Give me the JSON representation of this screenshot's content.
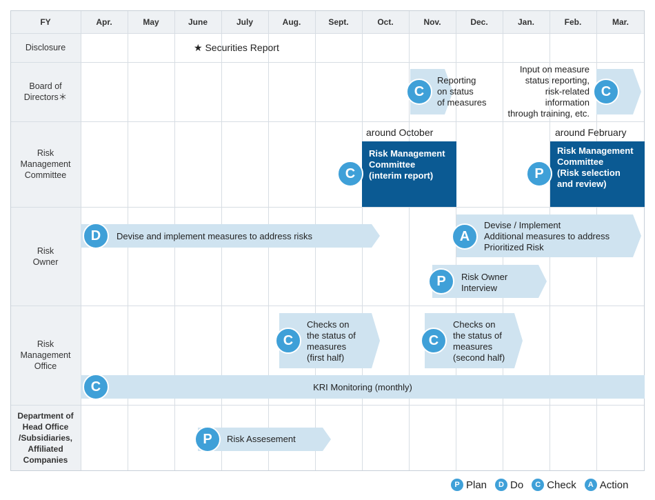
{
  "header": {
    "fy": "FY",
    "months": [
      "Apr.",
      "May",
      "June",
      "July",
      "Aug.",
      "Sept.",
      "Oct.",
      "Nov.",
      "Dec.",
      "Jan.",
      "Feb.",
      "Mar."
    ]
  },
  "rows": {
    "disclosure": "Disclosure",
    "board": "Board of\nDirectors＊",
    "rmc": "Risk\nManagement\nCommittee",
    "owner": "Risk\nOwner",
    "office": "Risk\nManagement\nOffice",
    "dept": "Department of\nHead Office\n/Subsidiaries,\nAffiliated\nCompanies"
  },
  "disclosure": {
    "star": "★",
    "text": "Securities Report"
  },
  "board": {
    "reporting": {
      "letter": "C",
      "text": "Reporting\non status\nof measures"
    },
    "input": {
      "letter": "C",
      "text": "Input on measure\nstatus reporting,\nrisk-related\ninformation\nthrough training, etc."
    }
  },
  "rmc": {
    "oct_note": "around October",
    "feb_note": "around February",
    "interim": {
      "letter": "C",
      "text": "Risk Management\nCommittee\n(interim report)"
    },
    "review": {
      "letter": "P",
      "text": "Risk Management\nCommittee\n(Risk selection\nand review)"
    }
  },
  "owner": {
    "devise": {
      "letter": "D",
      "text": "Devise and implement measures to address risks"
    },
    "additional": {
      "letter": "A",
      "text": "Devise / Implement\nAdditional measures to address\nPrioritized Risk"
    },
    "interview": {
      "letter": "P",
      "text": "Risk Owner\nInterview"
    }
  },
  "office": {
    "first": {
      "letter": "C",
      "text": "Checks on\nthe status of\nmeasures\n(first half)"
    },
    "second": {
      "letter": "C",
      "text": "Checks on\nthe status of\nmeasures\n(second half)"
    },
    "kri": {
      "letter": "C",
      "text": "KRI Monitoring (monthly)"
    }
  },
  "dept": {
    "assessment": {
      "letter": "P",
      "text": "Risk Assesement"
    }
  },
  "legend": [
    {
      "letter": "P",
      "label": "Plan"
    },
    {
      "letter": "D",
      "label": "Do"
    },
    {
      "letter": "C",
      "label": "Check"
    },
    {
      "letter": "A",
      "label": "Action"
    }
  ],
  "colors": {
    "arrow": "#cfe3f0",
    "box": "#0b5a93",
    "circle": "#3fa0d8",
    "grid": "#d7dde3",
    "label_bg": "#eef1f4"
  }
}
